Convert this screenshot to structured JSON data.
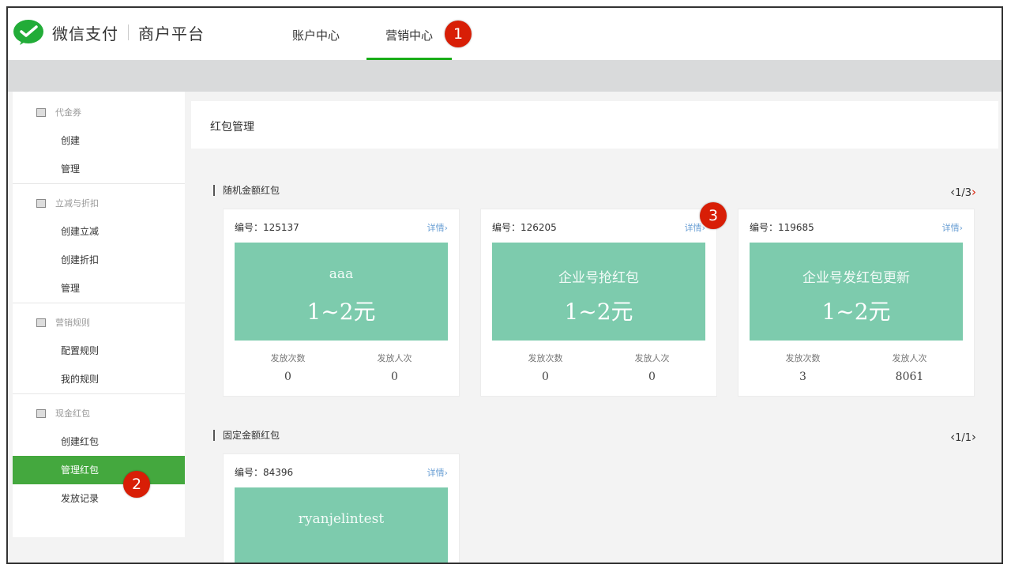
{
  "header": {
    "brand": "微信支付",
    "platform": "商户平台",
    "tabs": [
      {
        "label": "账户中心",
        "active": false
      },
      {
        "label": "营销中心",
        "active": true
      }
    ]
  },
  "badges": [
    "1",
    "2",
    "3"
  ],
  "sidebar": {
    "groups": [
      {
        "title": "代金券",
        "items": [
          {
            "label": "创建"
          },
          {
            "label": "管理"
          }
        ]
      },
      {
        "title": "立减与折扣",
        "items": [
          {
            "label": "创建立减"
          },
          {
            "label": "创建折扣"
          },
          {
            "label": "管理"
          }
        ]
      },
      {
        "title": "营销规则",
        "items": [
          {
            "label": "配置规则"
          },
          {
            "label": "我的规则"
          }
        ]
      },
      {
        "title": "现金红包",
        "items": [
          {
            "label": "创建红包"
          },
          {
            "label": "管理红包",
            "active": true
          },
          {
            "label": "发放记录"
          }
        ]
      }
    ]
  },
  "main": {
    "page_title": "红包管理",
    "random_section": {
      "label": "随机金额红包",
      "pager": {
        "prev": "‹",
        "text": "1/3",
        "next": "›"
      },
      "cards": [
        {
          "id_label": "编号：125137",
          "more": "详情›",
          "name": "aaa",
          "amount": "1~2元",
          "stat1_label": "发放次数",
          "stat1_value": "0",
          "stat2_label": "发放人次",
          "stat2_value": "0"
        },
        {
          "id_label": "编号：126205",
          "more": "详情›",
          "name": "企业号抢红包",
          "amount": "1~2元",
          "stat1_label": "发放次数",
          "stat1_value": "0",
          "stat2_label": "发放人次",
          "stat2_value": "0"
        },
        {
          "id_label": "编号：119685",
          "more": "详情›",
          "name": "企业号发红包更新",
          "amount": "1~2元",
          "stat1_label": "发放次数",
          "stat1_value": "3",
          "stat2_label": "发放人次",
          "stat2_value": "8061"
        }
      ]
    },
    "fixed_section": {
      "label": "固定金额红包",
      "pager": {
        "prev": "‹",
        "text": "1/1",
        "next": "›"
      },
      "cards": [
        {
          "id_label": "编号：84396",
          "more": "详情›",
          "name": "ryanjelintest"
        }
      ]
    }
  },
  "colors": {
    "brand_green": "#1aad19",
    "sidebar_active": "#44a83e",
    "card_banner": "#7dcbad",
    "badge_red": "#d81e06",
    "link_blue": "#6a9fd4"
  }
}
